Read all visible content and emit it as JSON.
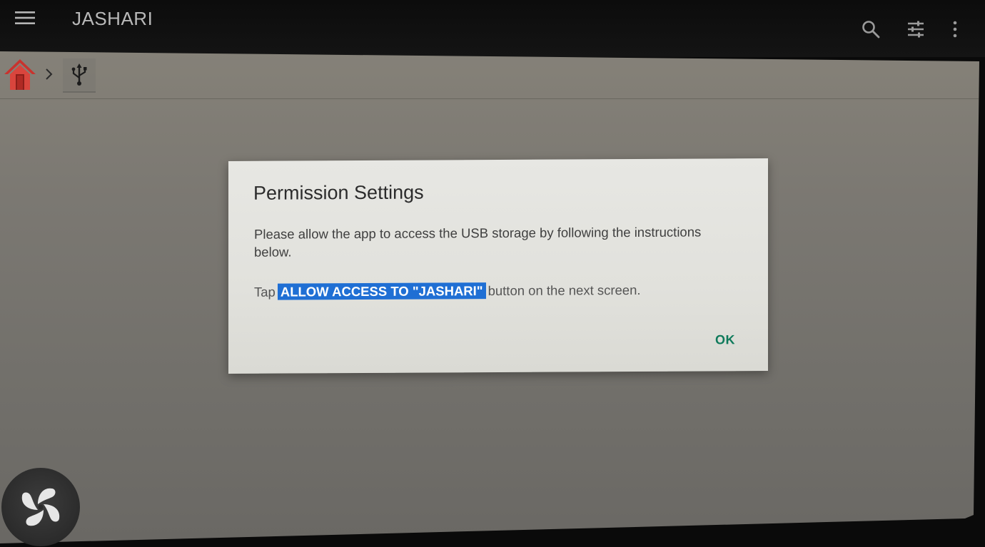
{
  "app": {
    "title": "JASHARI"
  },
  "toolbar": {
    "menu_icon": "hamburger-menu-icon",
    "search_icon": "search-icon",
    "filter_icon": "tune-sliders-icon",
    "more_icon": "more-vertical-icon"
  },
  "breadcrumb": {
    "home_icon": "home-icon",
    "separator_icon": "chevron-right-icon",
    "current_icon": "usb-icon"
  },
  "dialog": {
    "title": "Permission Settings",
    "message": "Please allow the app to access the USB storage by following the instructions below.",
    "instruction_prefix": "Tap",
    "instruction_highlight": "ALLOW ACCESS TO \"JASHARI\"",
    "instruction_suffix": "button on the next screen.",
    "ok_label": "OK"
  },
  "colors": {
    "accent_highlight": "#1f6fd4",
    "ok_text": "#0f7a5b",
    "home_icon": "#c8332e"
  },
  "floating": {
    "logo_icon": "pinwheel-logo-icon"
  }
}
